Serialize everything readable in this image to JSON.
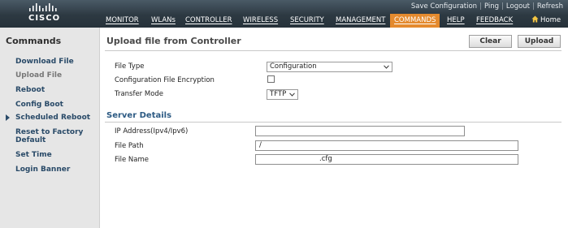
{
  "brand": {
    "logo_text": "CISCO"
  },
  "util_links": [
    "Save Configuration",
    "Ping",
    "Logout",
    "Refresh"
  ],
  "nav": {
    "items": [
      "MONITOR",
      "WLANs",
      "CONTROLLER",
      "WIRELESS",
      "SECURITY",
      "MANAGEMENT",
      "COMMANDS",
      "HELP",
      "FEEDBACK"
    ],
    "active": "COMMANDS",
    "home": "Home"
  },
  "sidebar": {
    "title": "Commands",
    "items": [
      "Download File",
      "Upload File",
      "Reboot",
      "Config Boot",
      "Scheduled Reboot",
      "Reset to Factory Default",
      "Set Time",
      "Login Banner"
    ],
    "current": "Upload File"
  },
  "page": {
    "title": "Upload file from Controller",
    "buttons": {
      "clear": "Clear",
      "upload": "Upload"
    }
  },
  "form": {
    "file_type_label": "File Type",
    "file_type_value": "Configuration",
    "encryption_label": "Configuration File Encryption",
    "encryption_checked": false,
    "transfer_mode_label": "Transfer Mode",
    "transfer_mode_value": "TFTP"
  },
  "server": {
    "title": "Server Details",
    "ip_label": "IP Address(Ipv4/Ipv6)",
    "ip_value": "",
    "path_label": "File Path",
    "path_value": "/",
    "name_label": "File Name",
    "name_value": ".cfg"
  },
  "colors": {
    "active_tab": "#e48a2e",
    "section_title": "#2c5a83",
    "sidebar_link": "#294a68"
  }
}
